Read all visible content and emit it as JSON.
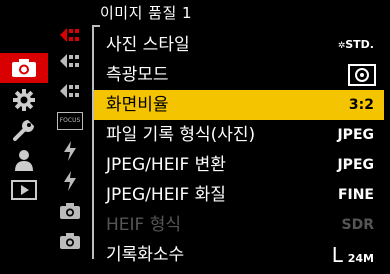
{
  "title": "이미지 품질 1",
  "left_tabs": [
    {
      "icon": "camera-icon",
      "active": true
    },
    {
      "icon": "gear-icon",
      "active": false
    },
    {
      "icon": "wrench-icon",
      "active": false
    },
    {
      "icon": "person-icon",
      "active": false
    },
    {
      "icon": "playback-icon",
      "active": false
    }
  ],
  "sub_tabs": [
    {
      "icon": "image-quality-icon-1"
    },
    {
      "icon": "image-quality-icon-2"
    },
    {
      "icon": "image-quality-icon-3"
    },
    {
      "icon": "focus-icon",
      "text": "FOCUS"
    },
    {
      "icon": "flash-icon-1"
    },
    {
      "icon": "flash-icon-2"
    },
    {
      "icon": "camera-small-icon-1"
    },
    {
      "icon": "camera-small-icon-2"
    }
  ],
  "menu": [
    {
      "label": "사진 스타일",
      "value": "STD.",
      "value_icon": "photo-style-icon"
    },
    {
      "label": "측광모드",
      "value": "",
      "value_icon": "metering-icon"
    },
    {
      "label": "화면비율",
      "value": "3:2",
      "selected": true
    },
    {
      "label": "파일 기록 형식(사진)",
      "value": "JPEG"
    },
    {
      "label": "JPEG/HEIF 변환",
      "value": "JPEG"
    },
    {
      "label": "JPEG/HEIF 화질",
      "value": "FINE"
    },
    {
      "label": "HEIF 형식",
      "value": "SDR",
      "disabled": true
    },
    {
      "label": "기록화소수",
      "value": "L",
      "value_suffix": "24M"
    }
  ],
  "colors": {
    "accent_tab": "#d80000",
    "selection": "#f5c400"
  }
}
